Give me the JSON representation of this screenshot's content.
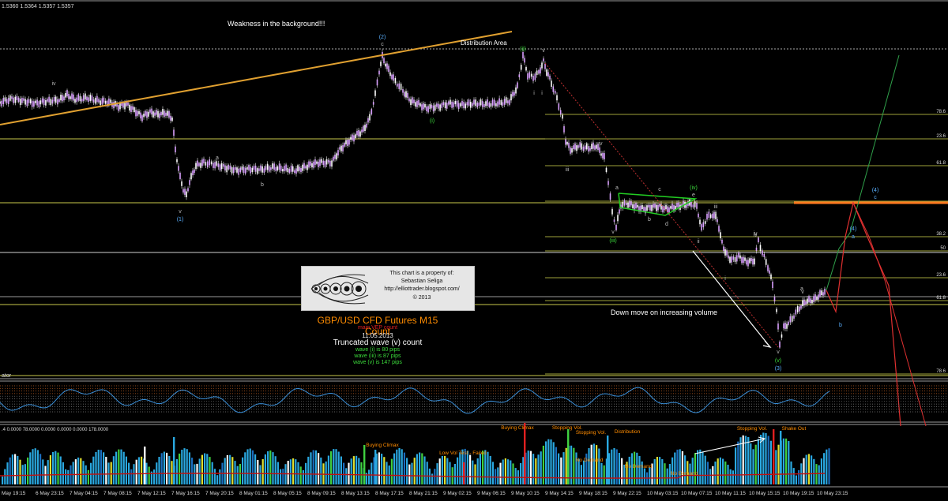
{
  "header": {
    "price_readout": "1.5360 1.5364 1.5357 1.5357"
  },
  "annotations": {
    "weakness": "Weakness in the background!!!",
    "distribution_area": "Distribution Area",
    "down_move": "Down move on increasing volume"
  },
  "watermark": {
    "line1": "This chart is a property of:",
    "line2": "Sebastian Seliga",
    "line3": "http://elliottrader.blogspot.com/",
    "copyright": "© 2013"
  },
  "title_block": {
    "title": "GBP/USD CFD Futures M15 Count",
    "subtitle": "main VEP count",
    "date": "11.05.2013",
    "count_title": "Truncated wave (v) count",
    "wave_i": "wave (i) is 80 pips",
    "wave_iii": "wave (iii) is 87 pips",
    "wave_v": "wave (v) is 147 pips"
  },
  "indicator_panel": {
    "label_fragment": "ator"
  },
  "volume_panel": {
    "readout": ".4 0.0000 78.0000 0.0000 0.0000 0.0000 178.0000",
    "labels": [
      "Buying Climax",
      "Stopping Vol.",
      "Stopping Vol.",
      "Distribution",
      "Buying Climax",
      "Low Vol Test - Failed",
      "No Demand",
      "No Demand",
      "No Demand",
      "Stopping Vol.",
      "Shake Out"
    ]
  },
  "fib_labels": [
    "78.6",
    "23.6",
    "61.8",
    "38.2",
    "50",
    "23.6",
    "61.8",
    "78.6"
  ],
  "wave_labels": [
    "(2)",
    "c",
    "(ii)",
    "v",
    "iv",
    "(i)",
    "(1)",
    "v",
    "a",
    "b",
    "i",
    "iii",
    "iv",
    "a",
    "c",
    "b",
    "d",
    "(iv)",
    "e",
    "(iii)",
    "ii",
    "iii",
    "iv",
    "i",
    "a",
    "v",
    "(v)",
    "(3)",
    "(4)",
    "c",
    "(4)",
    "a",
    "b",
    "v",
    "v",
    "i",
    "ii",
    "iv"
  ],
  "x_axis_labels": [
    "May 19:15",
    "6 May 23:15",
    "7 May 04:15",
    "7 May 08:15",
    "7 May 12:15",
    "7 May 16:15",
    "7 May 20:15",
    "8 May 01:15",
    "8 May 05:15",
    "8 May 09:15",
    "8 May 13:15",
    "8 May 17:15",
    "8 May 21:15",
    "9 May 02:15",
    "9 May 06:15",
    "9 May 10:15",
    "9 May 14:15",
    "9 May 18:15",
    "9 May 22:15",
    "10 May 03:15",
    "10 May 07:15",
    "10 May 11:15",
    "10 May 15:15",
    "10 May 19:15",
    "10 May 23:15"
  ],
  "colors": {
    "background": "#000000",
    "candle": "#d9a0ff",
    "fib_line": "#c8c84a",
    "trend_line": "#e0a030",
    "oscillator": "#3a8fd8",
    "volume_blue": "#2aa8e0",
    "volume_ma": "#c01010",
    "projection_red": "#e03030",
    "projection_green": "#2fa04a",
    "channel_green": "#22cc22",
    "resistance_orange": "#ff7a20"
  },
  "chart_data": {
    "type": "candlestick",
    "title": "GBP/USD CFD Futures M15 Count",
    "series_close_path": [
      1.553,
      1.554,
      1.5525,
      1.5505,
      1.546,
      1.543,
      1.54,
      1.542,
      1.543,
      1.5425,
      1.544,
      1.546,
      1.55,
      1.554,
      1.559,
      1.5585,
      1.555,
      1.5545,
      1.555,
      1.556,
      1.559,
      1.558,
      1.55,
      1.547,
      1.546,
      1.542,
      1.541,
      1.54,
      1.5395,
      1.538,
      1.54,
      1.541,
      1.5405,
      1.537,
      1.534,
      1.533,
      1.5315,
      1.535,
      1.537,
      1.538
    ]
  }
}
